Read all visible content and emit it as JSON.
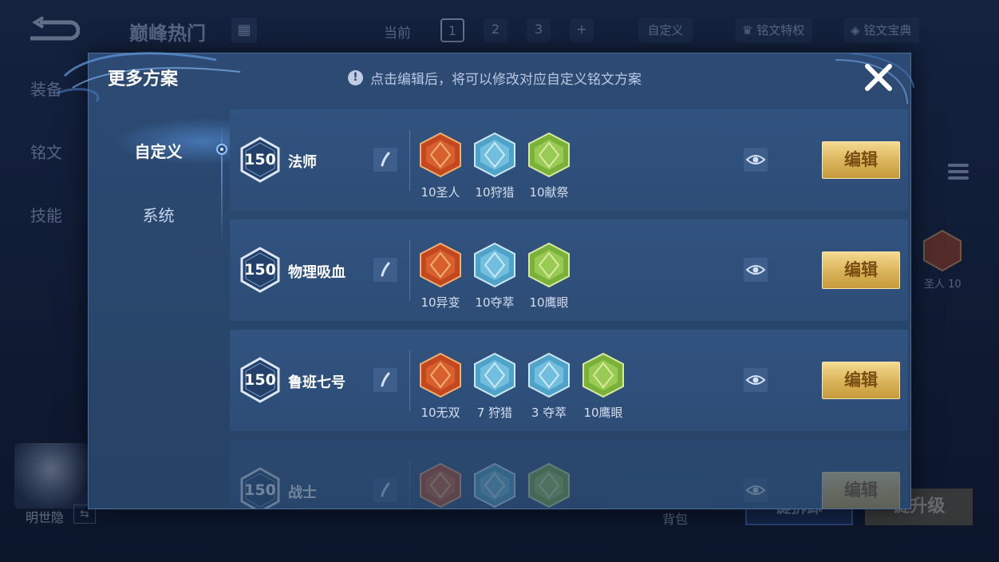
{
  "background": {
    "title": "巅峰热门",
    "current_label": "当前",
    "pages": [
      "1",
      "2",
      "3",
      "+"
    ],
    "custom_label": "自定义",
    "privilege_label": "铭文特权",
    "codex_label": "铭文宝典",
    "side_tabs": [
      "装备",
      "铭文",
      "技能"
    ],
    "rune_preview_label": "圣人 10",
    "hero_name": "明世隐",
    "hero_swap_icon": "⇆",
    "bag_label": "背包",
    "btn_left_label": "键拆卸",
    "btn_right_label": "键升级"
  },
  "modal": {
    "title": "更多方案",
    "hint_icon": "!",
    "hint": "点击编辑后，将可以修改对应自定义铭文方案",
    "close_icon": "close-icon"
  },
  "nav": {
    "items": [
      {
        "label": "自定义",
        "active": true
      },
      {
        "label": "系统",
        "active": false
      }
    ]
  },
  "colors": {
    "red_rune": "#c3471f",
    "blue_rune": "#4fa3c9",
    "green_rune": "#79b13a",
    "gold_button": "#d9b35a"
  },
  "schemes": [
    {
      "level": "150",
      "name": "法师",
      "edit_label": "编辑",
      "runes": [
        {
          "color": "red",
          "label": "10圣人"
        },
        {
          "color": "blue",
          "label": "10狩猎"
        },
        {
          "color": "green",
          "label": "10献祭"
        }
      ]
    },
    {
      "level": "150",
      "name": "物理吸血",
      "edit_label": "编辑",
      "runes": [
        {
          "color": "red",
          "label": "10异变"
        },
        {
          "color": "blue",
          "label": "10夺萃"
        },
        {
          "color": "green",
          "label": "10鹰眼"
        }
      ]
    },
    {
      "level": "150",
      "name": "鲁班七号",
      "edit_label": "编辑",
      "runes": [
        {
          "color": "red",
          "label": "10无双"
        },
        {
          "color": "blue",
          "label": "7 狩猎"
        },
        {
          "color": "blue",
          "label": "3 夺萃"
        },
        {
          "color": "green",
          "label": "10鹰眼"
        }
      ]
    },
    {
      "level": "150",
      "name": "战士",
      "edit_label": "编辑",
      "runes": [
        {
          "color": "red",
          "label": ""
        },
        {
          "color": "blue",
          "label": ""
        },
        {
          "color": "green",
          "label": ""
        }
      ]
    }
  ]
}
